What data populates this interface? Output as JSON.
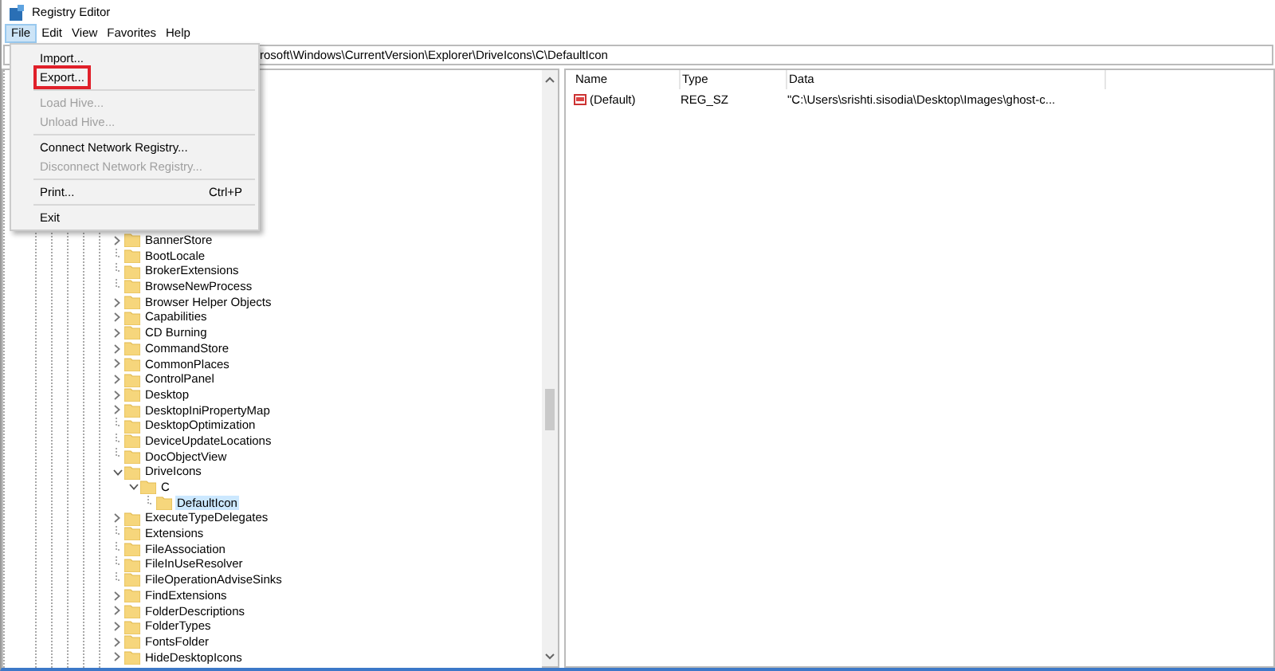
{
  "window": {
    "title": "Registry Editor"
  },
  "menu_bar": [
    {
      "label": "File",
      "selected": true
    },
    {
      "label": "Edit",
      "selected": false
    },
    {
      "label": "View",
      "selected": false
    },
    {
      "label": "Favorites",
      "selected": false
    },
    {
      "label": "Help",
      "selected": false
    }
  ],
  "address_bar": {
    "value": "rosoft\\Windows\\CurrentVersion\\Explorer\\DriveIcons\\C\\DefaultIcon"
  },
  "file_menu": [
    {
      "kind": "item",
      "label": "Import...",
      "disabled": false,
      "highlighted": false
    },
    {
      "kind": "item",
      "label": "Export...",
      "disabled": false,
      "highlighted": true
    },
    {
      "kind": "separator"
    },
    {
      "kind": "item",
      "label": "Load Hive...",
      "disabled": true,
      "highlighted": false
    },
    {
      "kind": "item",
      "label": "Unload Hive...",
      "disabled": true,
      "highlighted": false
    },
    {
      "kind": "separator"
    },
    {
      "kind": "item",
      "label": "Connect Network Registry...",
      "disabled": false,
      "highlighted": false
    },
    {
      "kind": "item",
      "label": "Disconnect Network Registry...",
      "disabled": true,
      "highlighted": false
    },
    {
      "kind": "separator"
    },
    {
      "kind": "item",
      "label": "Print...",
      "shortcut": "Ctrl+P",
      "disabled": false,
      "highlighted": false
    },
    {
      "kind": "separator"
    },
    {
      "kind": "item",
      "label": "Exit",
      "disabled": false,
      "highlighted": false
    }
  ],
  "tree": [
    {
      "label": "BannerStore",
      "has_children": true,
      "expanded": false,
      "selected": false
    },
    {
      "label": "BootLocale",
      "has_children": false,
      "selected": false
    },
    {
      "label": "BrokerExtensions",
      "has_children": false,
      "selected": false
    },
    {
      "label": "BrowseNewProcess",
      "has_children": false,
      "selected": false
    },
    {
      "label": "Browser Helper Objects",
      "has_children": true,
      "expanded": false,
      "selected": false
    },
    {
      "label": "Capabilities",
      "has_children": true,
      "expanded": false,
      "selected": false
    },
    {
      "label": "CD Burning",
      "has_children": true,
      "expanded": false,
      "selected": false
    },
    {
      "label": "CommandStore",
      "has_children": true,
      "expanded": false,
      "selected": false
    },
    {
      "label": "CommonPlaces",
      "has_children": true,
      "expanded": false,
      "selected": false
    },
    {
      "label": "ControlPanel",
      "has_children": true,
      "expanded": false,
      "selected": false
    },
    {
      "label": "Desktop",
      "has_children": true,
      "expanded": false,
      "selected": false
    },
    {
      "label": "DesktopIniPropertyMap",
      "has_children": true,
      "expanded": false,
      "selected": false
    },
    {
      "label": "DesktopOptimization",
      "has_children": false,
      "selected": false
    },
    {
      "label": "DeviceUpdateLocations",
      "has_children": false,
      "selected": false
    },
    {
      "label": "DocObjectView",
      "has_children": false,
      "selected": false
    },
    {
      "label": "DriveIcons",
      "has_children": true,
      "expanded": true,
      "selected": false,
      "children": [
        {
          "label": "C",
          "has_children": true,
          "expanded": true,
          "selected": false,
          "children": [
            {
              "label": "DefaultIcon",
              "has_children": false,
              "selected": true
            }
          ]
        }
      ]
    },
    {
      "label": "ExecuteTypeDelegates",
      "has_children": true,
      "expanded": false,
      "selected": false
    },
    {
      "label": "Extensions",
      "has_children": false,
      "selected": false
    },
    {
      "label": "FileAssociation",
      "has_children": false,
      "selected": false
    },
    {
      "label": "FileInUseResolver",
      "has_children": false,
      "selected": false
    },
    {
      "label": "FileOperationAdviseSinks",
      "has_children": false,
      "selected": false
    },
    {
      "label": "FindExtensions",
      "has_children": true,
      "expanded": false,
      "selected": false
    },
    {
      "label": "FolderDescriptions",
      "has_children": true,
      "expanded": false,
      "selected": false
    },
    {
      "label": "FolderTypes",
      "has_children": true,
      "expanded": false,
      "selected": false
    },
    {
      "label": "FontsFolder",
      "has_children": true,
      "expanded": false,
      "selected": false
    },
    {
      "label": "HideDesktopIcons",
      "has_children": true,
      "expanded": false,
      "selected": false
    }
  ],
  "values": {
    "columns": [
      "Name",
      "Type",
      "Data"
    ],
    "rows": [
      {
        "name": "(Default)",
        "type": "REG_SZ",
        "data": "\"C:\\Users\\srishti.sisodia\\Desktop\\Images\\ghost-c..."
      }
    ]
  }
}
